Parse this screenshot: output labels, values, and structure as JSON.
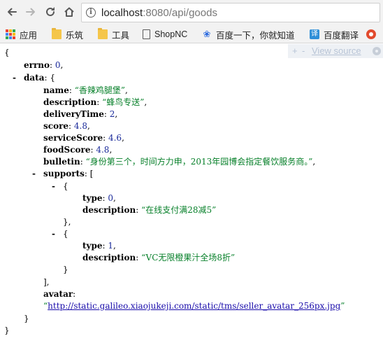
{
  "browser": {
    "url_host": "localhost",
    "url_rest": ":8080/api/goods"
  },
  "bookmarks": [
    {
      "icon": "apps-icon",
      "label": "应用"
    },
    {
      "icon": "folder-icon",
      "label": "乐筑"
    },
    {
      "icon": "folder-icon",
      "label": "工具"
    },
    {
      "icon": "page-icon",
      "label": "ShopNC"
    },
    {
      "icon": "baidu-paw-icon",
      "label": "百度一下，你就知道"
    },
    {
      "icon": "translate-icon",
      "label": "百度翻译"
    },
    {
      "icon": "extension-icon",
      "label": ""
    }
  ],
  "viewer": {
    "plus": "+",
    "minus": "-",
    "view_source": "View source"
  },
  "json": {
    "open_brace": "{",
    "errno_key": "errno",
    "errno_val": "0",
    "data_key": "data",
    "name_key": "name",
    "name_val": "“香辣鸡腿堡”",
    "description_key": "description",
    "description_val": "“蜂鸟专送”",
    "deliveryTime_key": "deliveryTime",
    "deliveryTime_val": "2",
    "score_key": "score",
    "score_val": "4.8",
    "serviceScore_key": "serviceScore",
    "serviceScore_val": "4.6",
    "foodScore_key": "foodScore",
    "foodScore_val": "4.8",
    "bulletin_key": "bulletin",
    "bulletin_val": "“身份第三个，时间方力申，2013年园博会指定餐饮服务商。”",
    "supports_key": "supports",
    "support0_type_key": "type",
    "support0_type_val": "0",
    "support0_desc_key": "description",
    "support0_desc_val": "“在线支付满28减5”",
    "support1_type_key": "type",
    "support1_type_val": "1",
    "support1_desc_key": "description",
    "support1_desc_val": "“VC无限橙果汁全场8折”",
    "avatar_key": "avatar",
    "avatar_val": "http://static.galileo.xiaojukeji.com/static/tms/seller_avatar_256px.jpg"
  },
  "colors": {
    "string": "#07802a",
    "number": "#1a2a9a",
    "link": "#1a0dab",
    "toolbar": "#f2f2f2"
  }
}
